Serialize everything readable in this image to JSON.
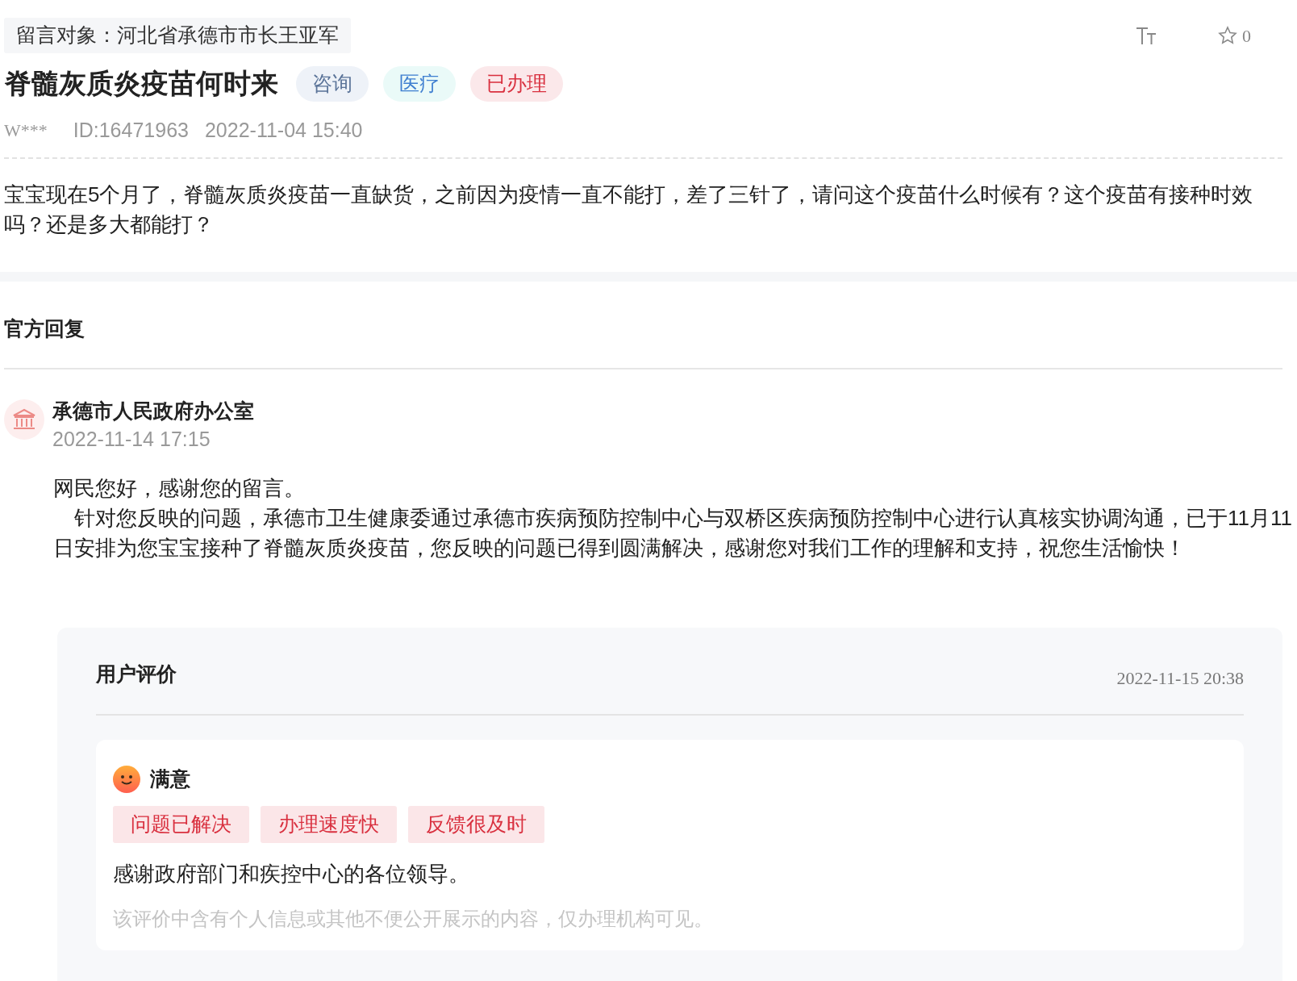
{
  "recipient": "留言对象：河北省承德市市长王亚军",
  "toolbar": {
    "favorites_count": "0"
  },
  "title": "脊髓灰质炎疫苗何时来",
  "tags": [
    {
      "label": "咨询",
      "color": "#5a7398"
    },
    {
      "label": "医疗",
      "color": "#3f7fd0"
    },
    {
      "label": "已办理",
      "color": "#d9303f"
    }
  ],
  "meta": {
    "author": "W***",
    "id": "ID:16471963",
    "time": "2022-11-04 15:40"
  },
  "message": "宝宝现在5个月了，脊髓灰质炎疫苗一直缺货，之前因为疫情一直不能打，差了三针了，请问这个疫苗什么时候有？这个疫苗有接种时效吗？还是多大都能打？",
  "reply_section": {
    "heading": "官方回复",
    "replier": "承德市人民政府办公室",
    "time": "2022-11-14 17:15",
    "paragraphs": [
      "网民您好，感谢您的留言。",
      "　针对您反映的问题，承德市卫生健康委通过承德市疾病预防控制中心与双桥区疾病预防控制中心进行认真核实协调沟通，已于11月11日安排为您宝宝接种了脊髓灰质炎疫苗，您反映的问题已得到圆满解决，感谢您对我们工作的理解和支持，祝您生活愉快！"
    ]
  },
  "evaluation": {
    "heading": "用户评价",
    "time": "2022-11-15 20:38",
    "rating": "满意",
    "tags": [
      "问题已解决",
      "办理速度快",
      "反馈很及时"
    ],
    "comment": "感谢政府部门和疾控中心的各位领导。",
    "notice": "该评价中含有个人信息或其他不便公开展示的内容，仅办理机构可见。"
  }
}
